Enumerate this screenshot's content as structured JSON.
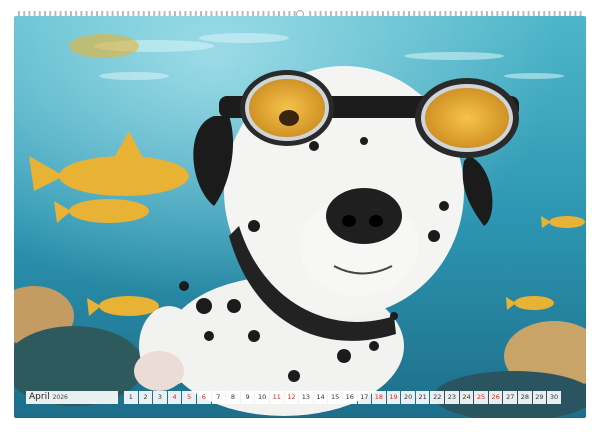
{
  "calendar": {
    "month": "April",
    "year": "2026",
    "days": [
      "1",
      "2",
      "3",
      "4",
      "5",
      "6",
      "7",
      "8",
      "9",
      "10",
      "11",
      "12",
      "13",
      "14",
      "15",
      "16",
      "17",
      "18",
      "19",
      "20",
      "21",
      "22",
      "23",
      "24",
      "25",
      "26",
      "27",
      "28",
      "29",
      "30"
    ],
    "red_days": [
      "4",
      "5",
      "6",
      "11",
      "12",
      "18",
      "19",
      "25",
      "26"
    ]
  },
  "colors": {
    "water_top": "#2f9fb8",
    "water_bottom": "#1f7f98",
    "fish": "#e8b234",
    "goggle_lens": "#f0b43a",
    "weekend": "#d32b2b"
  }
}
